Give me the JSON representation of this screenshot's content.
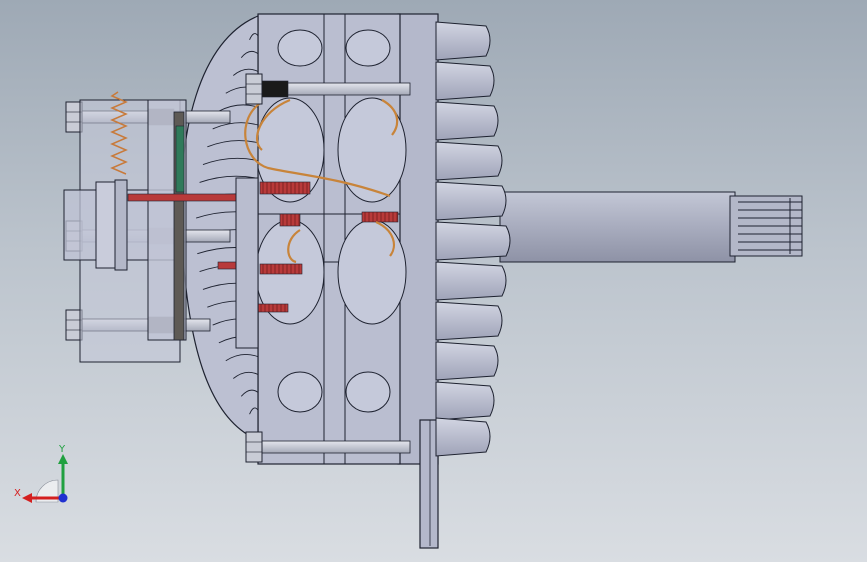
{
  "viewport": {
    "background_top": "#9ea9b5",
    "background_bottom": "#d9dde2"
  },
  "model": {
    "body_color": "#b9bdd0",
    "line_color": "#1e2230",
    "shaft_color": "#a9adbf",
    "bolt_color": "#c9ccd6",
    "spring_color": "#c87a3a",
    "wire_color": "#c8843a",
    "brush_red": "#b83a3a",
    "contact_dark": "#1a1a1a",
    "board_green": "#2f7a5a"
  },
  "triad": {
    "x_label": "X",
    "y_label": "Y",
    "x_color": "#d42020",
    "y_color": "#20a040",
    "z_color": "#2030d0"
  }
}
